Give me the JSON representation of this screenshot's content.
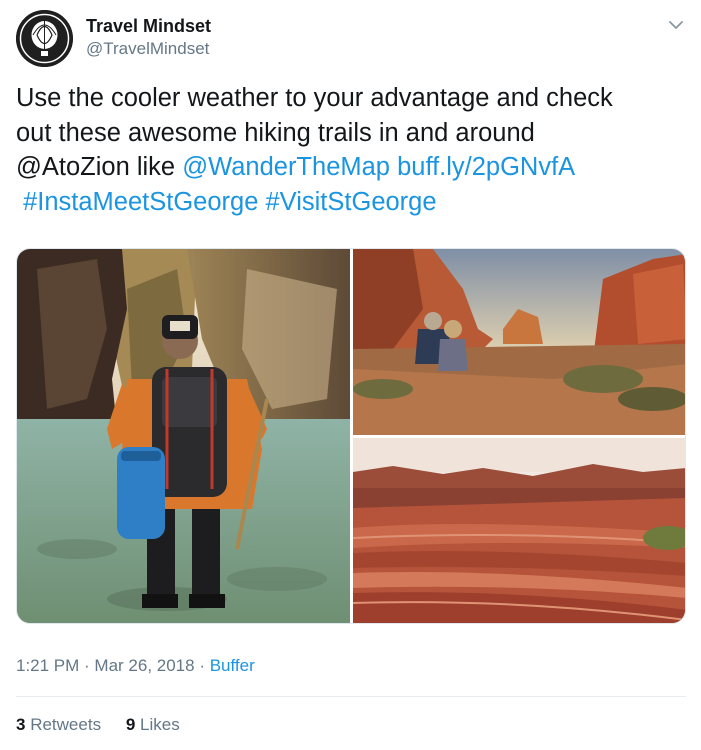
{
  "user": {
    "name": "Travel Mindset",
    "handle": "@TravelMindset",
    "avatar_icon": "hot-air-balloon-icon"
  },
  "menu_icon": "chevron-down-icon",
  "tweet": {
    "line1": "Use the cooler weather to your advantage and check",
    "line2": "out these awesome hiking trails in and around",
    "line3_text": "@AtoZion like ",
    "mention": "@WanderTheMap",
    "space": " ",
    "url": "buff.ly/2pGNvfA",
    "hashtag1": "#InstaMeetStGeorge",
    "hashtag2": "#VisitStGeorge"
  },
  "media": [
    {
      "description": "hiker-in-narrows-canyon"
    },
    {
      "description": "couple-sitting-red-rock-canyon"
    },
    {
      "description": "red-sandstone-waves"
    }
  ],
  "meta": {
    "time": "1:21 PM",
    "sep1": " · ",
    "date": "Mar 26, 2018",
    "sep2": " · ",
    "source": "Buffer"
  },
  "stats": {
    "retweets_count": "3",
    "retweets_label": "Retweets",
    "likes_count": "9",
    "likes_label": "Likes"
  },
  "colors": {
    "link": "#1b95e0",
    "secondary_text": "#657786",
    "primary_text": "#14171a",
    "divider": "#e6ecf0"
  }
}
